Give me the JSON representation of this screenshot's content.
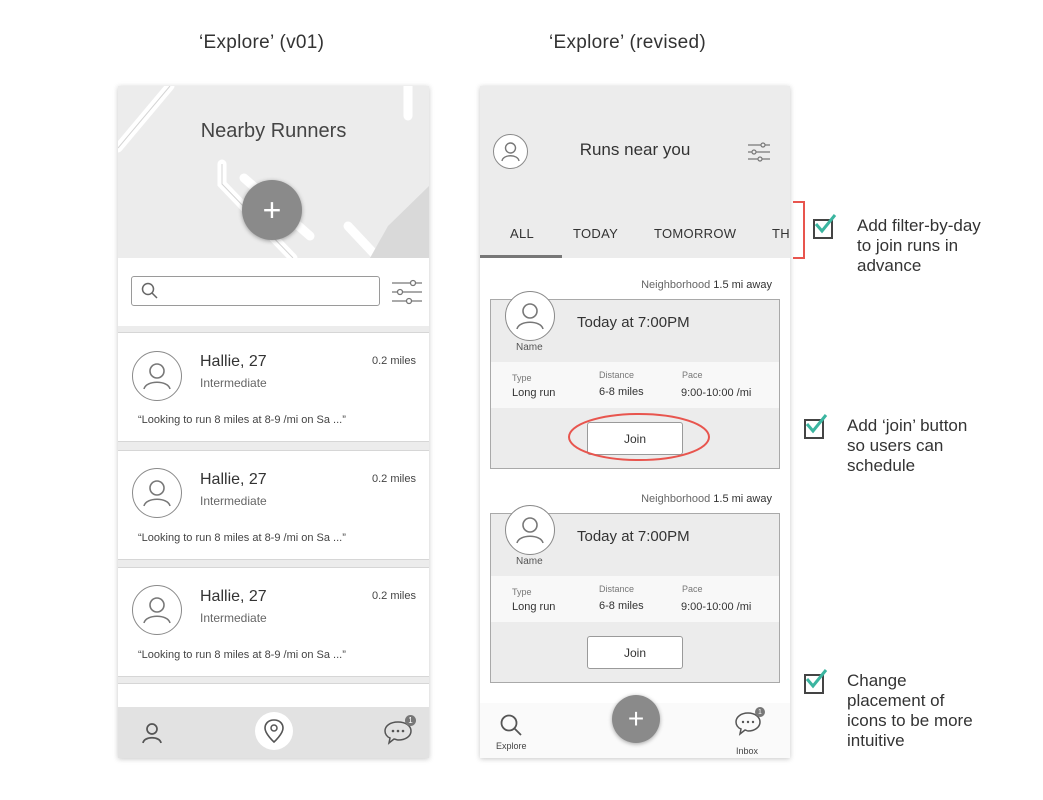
{
  "captions": {
    "left": "‘Explore’ (v01)",
    "right": "‘Explore’ (revised)"
  },
  "v01": {
    "map_title": "Nearby Runners",
    "fab_icon": "plus",
    "search_placeholder": "",
    "cards": [
      {
        "name": "Hallie, 27",
        "level": "Intermediate",
        "distance": "0.2 miles",
        "quote": "“Looking to run 8 miles at 8-9 /mi on Sa ...”"
      },
      {
        "name": "Hallie, 27",
        "level": "Intermediate",
        "distance": "0.2 miles",
        "quote": "“Looking to run 8 miles at 8-9 /mi on Sa ...”"
      },
      {
        "name": "Hallie, 27",
        "level": "Intermediate",
        "distance": "0.2 miles",
        "quote": "“Looking to run 8 miles at 8-9 /mi on Sa ...”"
      }
    ],
    "tabbar": {
      "badge": "1"
    }
  },
  "revised": {
    "title": "Runs near you",
    "tabs": [
      "ALL",
      "TODAY",
      "TOMORROW",
      "TH"
    ],
    "active_tab": "ALL",
    "runs": [
      {
        "neighborhood": "Neighborhood",
        "away": "1.5 mi away",
        "when": "Today at 7:00PM",
        "avatar_label": "Name",
        "type_label": "Type",
        "type": "Long run",
        "distance_label": "Distance",
        "distance": "6-8 miles",
        "pace_label": "Pace",
        "pace": "9:00-10:00 /mi",
        "join_label": "Join",
        "highlighted": true
      },
      {
        "neighborhood": "Neighborhood",
        "away": "1.5 mi away",
        "when": "Today at 7:00PM",
        "avatar_label": "Name",
        "type_label": "Type",
        "type": "Long run",
        "distance_label": "Distance",
        "distance": "6-8 miles",
        "pace_label": "Pace",
        "pace": "9:00-10:00 /mi",
        "join_label": "Join",
        "highlighted": false
      }
    ],
    "tabbar": {
      "explore_label": "Explore",
      "inbox_label": "Inbox",
      "badge": "1"
    }
  },
  "annotations": [
    {
      "text": "Add filter-by-day to join runs in advance",
      "lines": [
        "Add filter-by-day",
        "to join runs in",
        "advance"
      ]
    },
    {
      "text": "Add ‘join’ button so users can schedule",
      "lines": [
        "Add ‘join’ button",
        "so users can",
        "schedule"
      ]
    },
    {
      "text": "Change placement of icons to be more intuitive",
      "lines": [
        "Change",
        "placement of",
        "icons to be more",
        "intuitive"
      ]
    }
  ],
  "colors": {
    "highlight": "#e8554e",
    "check": "#3bb5a0",
    "fab": "#8a8a8a"
  }
}
